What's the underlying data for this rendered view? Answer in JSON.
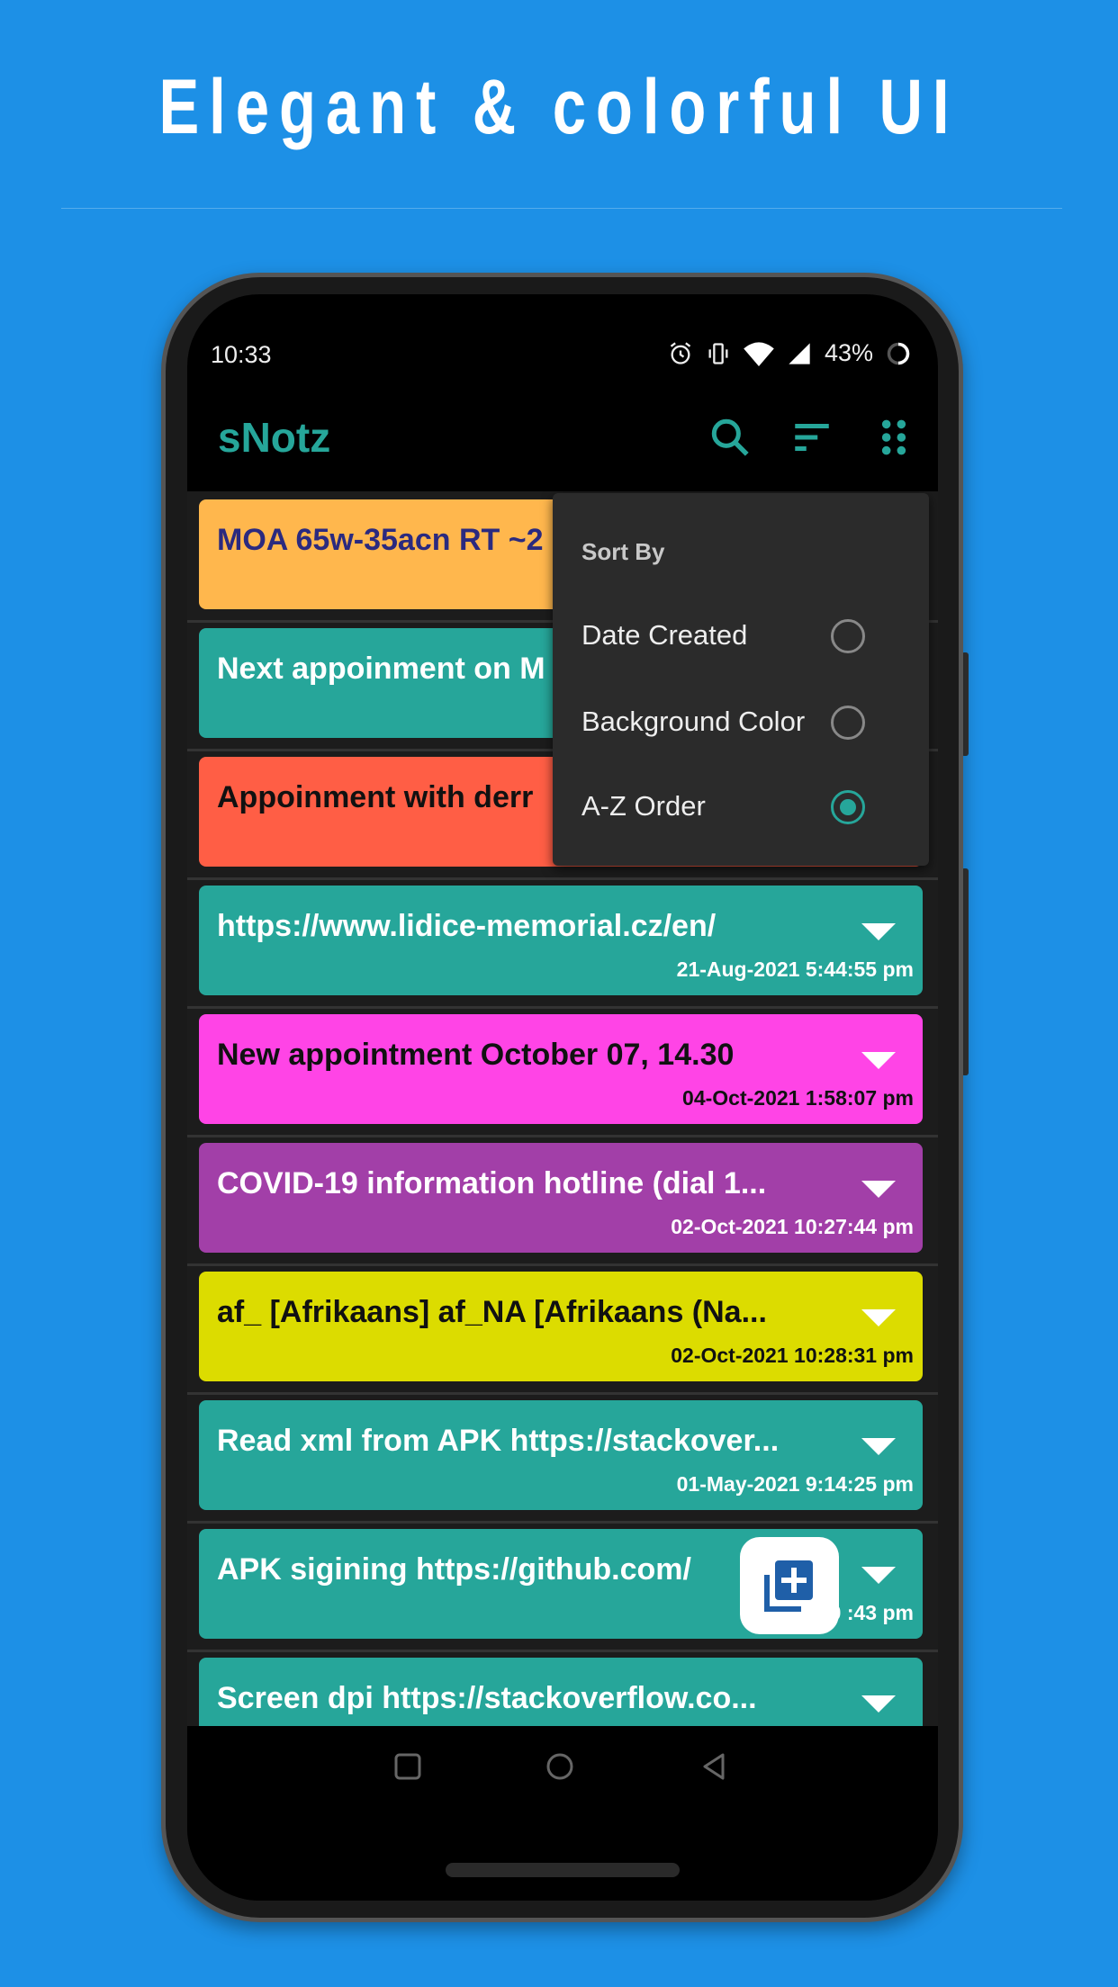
{
  "headline": "Elegant & colorful UI",
  "status_bar": {
    "time": "10:33",
    "battery": "43%",
    "icons": [
      "alarm-icon",
      "vibrate-icon",
      "wifi-icon",
      "signal-icon",
      "battery-ring-icon"
    ]
  },
  "app_bar": {
    "title": "sNotz",
    "icons": [
      "search-icon",
      "sort-icon",
      "grid-dots-icon"
    ],
    "accent": "#26a69a"
  },
  "sort_menu": {
    "title": "Sort By",
    "options": [
      {
        "label": "Date Created",
        "selected": false
      },
      {
        "label": "Background Color",
        "selected": false
      },
      {
        "label": "A-Z Order",
        "selected": true
      }
    ]
  },
  "notes": [
    {
      "title": "MOA 65w-35acn RT ~2",
      "date": "",
      "bg": "#ffb74d",
      "fg": "#2b2a7f"
    },
    {
      "title": "Next appoinment on M",
      "date": "",
      "bg": "#26a69a",
      "fg": "#ffffff"
    },
    {
      "title": "Appoinment with derr",
      "date": "",
      "bg": "#ff5e45",
      "fg": "#111111"
    },
    {
      "title": "https://www.lidice-memorial.cz/en/",
      "date": "21-Aug-2021 5:44:55 pm",
      "bg": "#26a69a",
      "fg": "#ffffff"
    },
    {
      "title": "New appointment October 07, 14.30",
      "date": "04-Oct-2021 1:58:07 pm",
      "bg": "#ff44e6",
      "fg": "#111111"
    },
    {
      "title": "COVID-19 information hotline (dial 1...",
      "date": "02-Oct-2021 10:27:44 pm",
      "bg": "#a23fa8",
      "fg": "#ffffff"
    },
    {
      "title": "af_ [Afrikaans] af_NA [Afrikaans (Na...",
      "date": "02-Oct-2021 10:28:31 pm",
      "bg": "#dcdc00",
      "fg": "#111111"
    },
    {
      "title": "Read xml from APK https://stackover...",
      "date": "01-May-2021 9:14:25 pm",
      "bg": "#26a69a",
      "fg": "#ffffff"
    },
    {
      "title": "APK sigining https://github.com/",
      "date": "18-Mar-20    :43 pm",
      "bg": "#26a69a",
      "fg": "#ffffff"
    },
    {
      "title": "Screen dpi https://stackoverflow.co...",
      "date": "",
      "bg": "#26a69a",
      "fg": "#ffffff"
    }
  ],
  "fab": {
    "icon": "add-note-icon",
    "color": "#1f5fa8"
  },
  "nav": {
    "icons": [
      "recents-icon",
      "home-icon",
      "back-icon"
    ]
  }
}
